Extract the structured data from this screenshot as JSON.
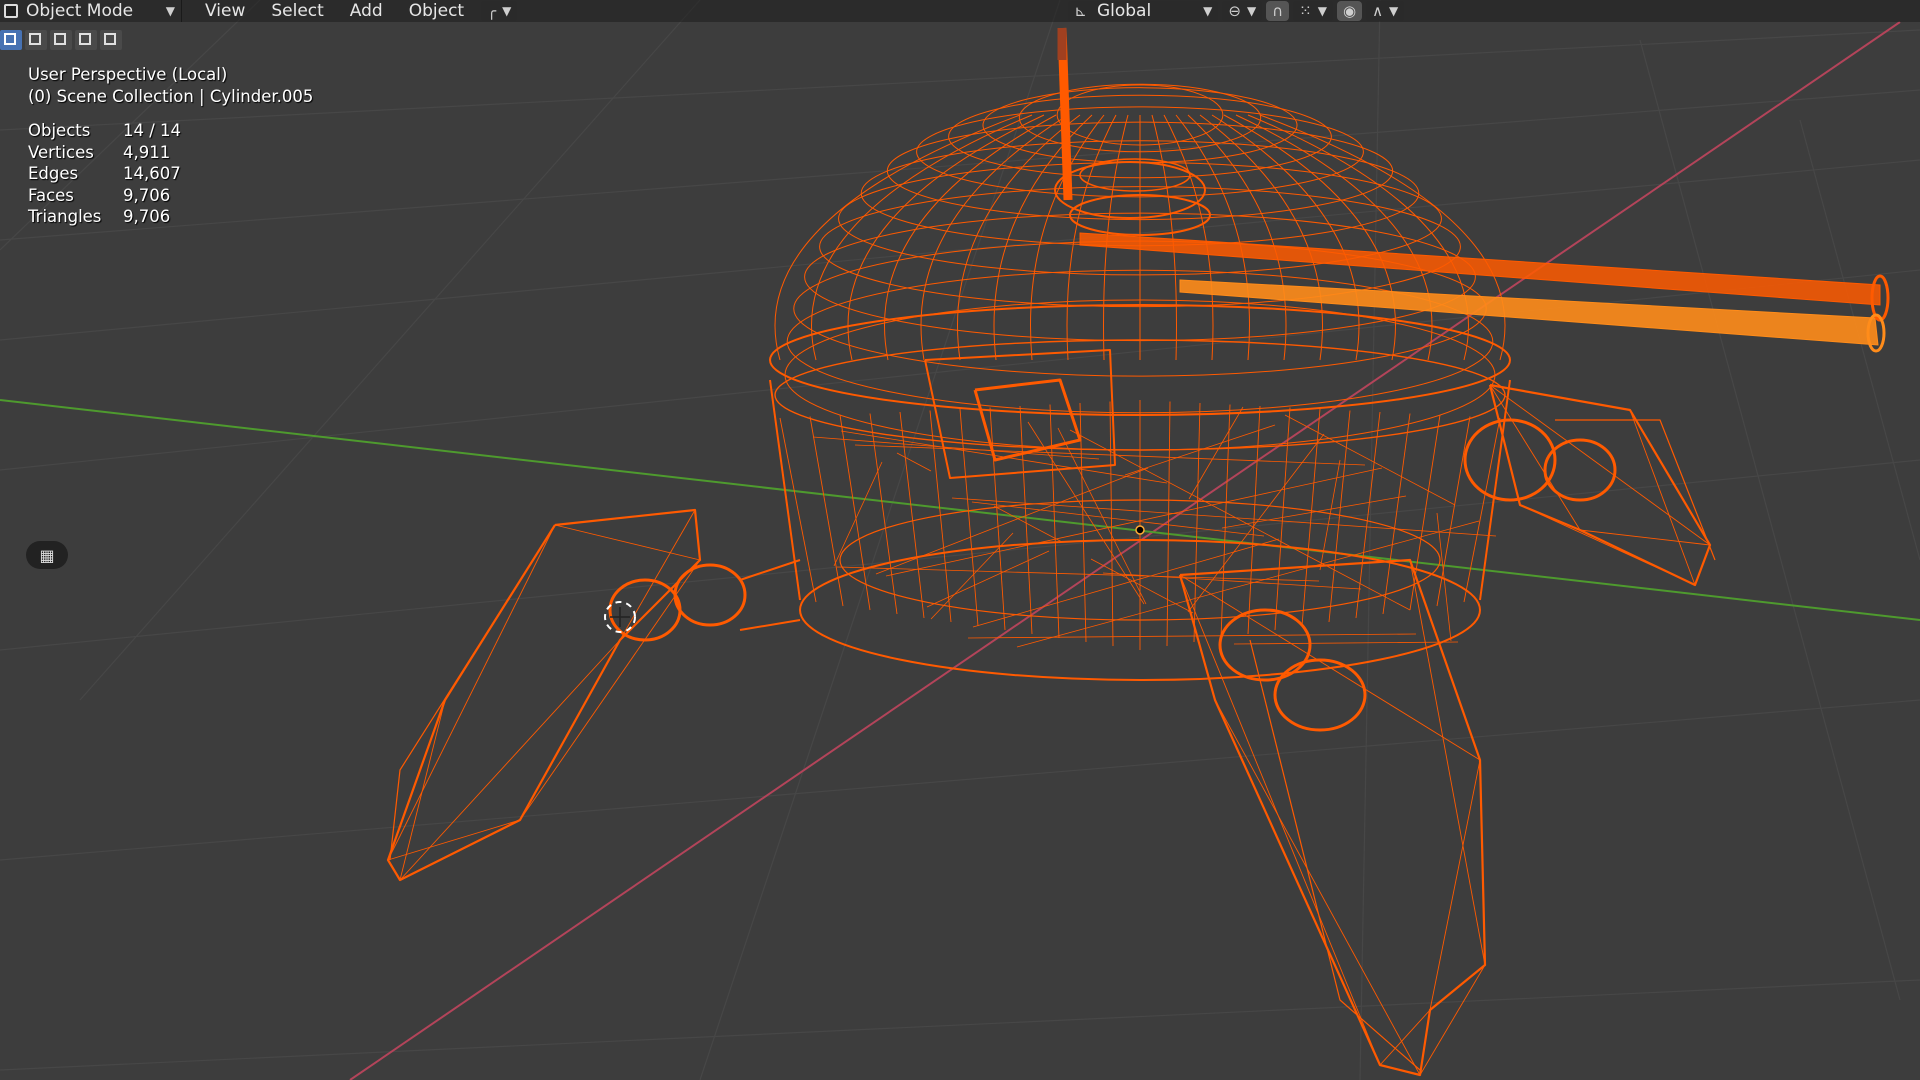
{
  "header": {
    "mode_label": "Object Mode",
    "menus": [
      "View",
      "Select",
      "Add",
      "Object"
    ],
    "orientation_label": "Global"
  },
  "viewport": {
    "perspective": "User Perspective (Local)",
    "collection": "(0) Scene Collection | Cylinder.005"
  },
  "stats": [
    {
      "label": "Objects",
      "value": "14 / 14"
    },
    {
      "label": "Vertices",
      "value": "4,911"
    },
    {
      "label": "Edges",
      "value": "14,607"
    },
    {
      "label": "Faces",
      "value": "9,706"
    },
    {
      "label": "Triangles",
      "value": "9,706"
    }
  ],
  "colors": {
    "wire": "#ff5a00",
    "wire_bright": "#ff8c1a",
    "background": "#3d3d3d",
    "grid": "#474747",
    "axis_x": "#b3445a",
    "axis_y": "#4e9a2e",
    "active": "#4772b3"
  },
  "icons": {
    "mode": "object-mode-icon",
    "transform": "transform-orientation-icon",
    "snap": "snap-icon",
    "camera": "camera-toggle-icon"
  }
}
